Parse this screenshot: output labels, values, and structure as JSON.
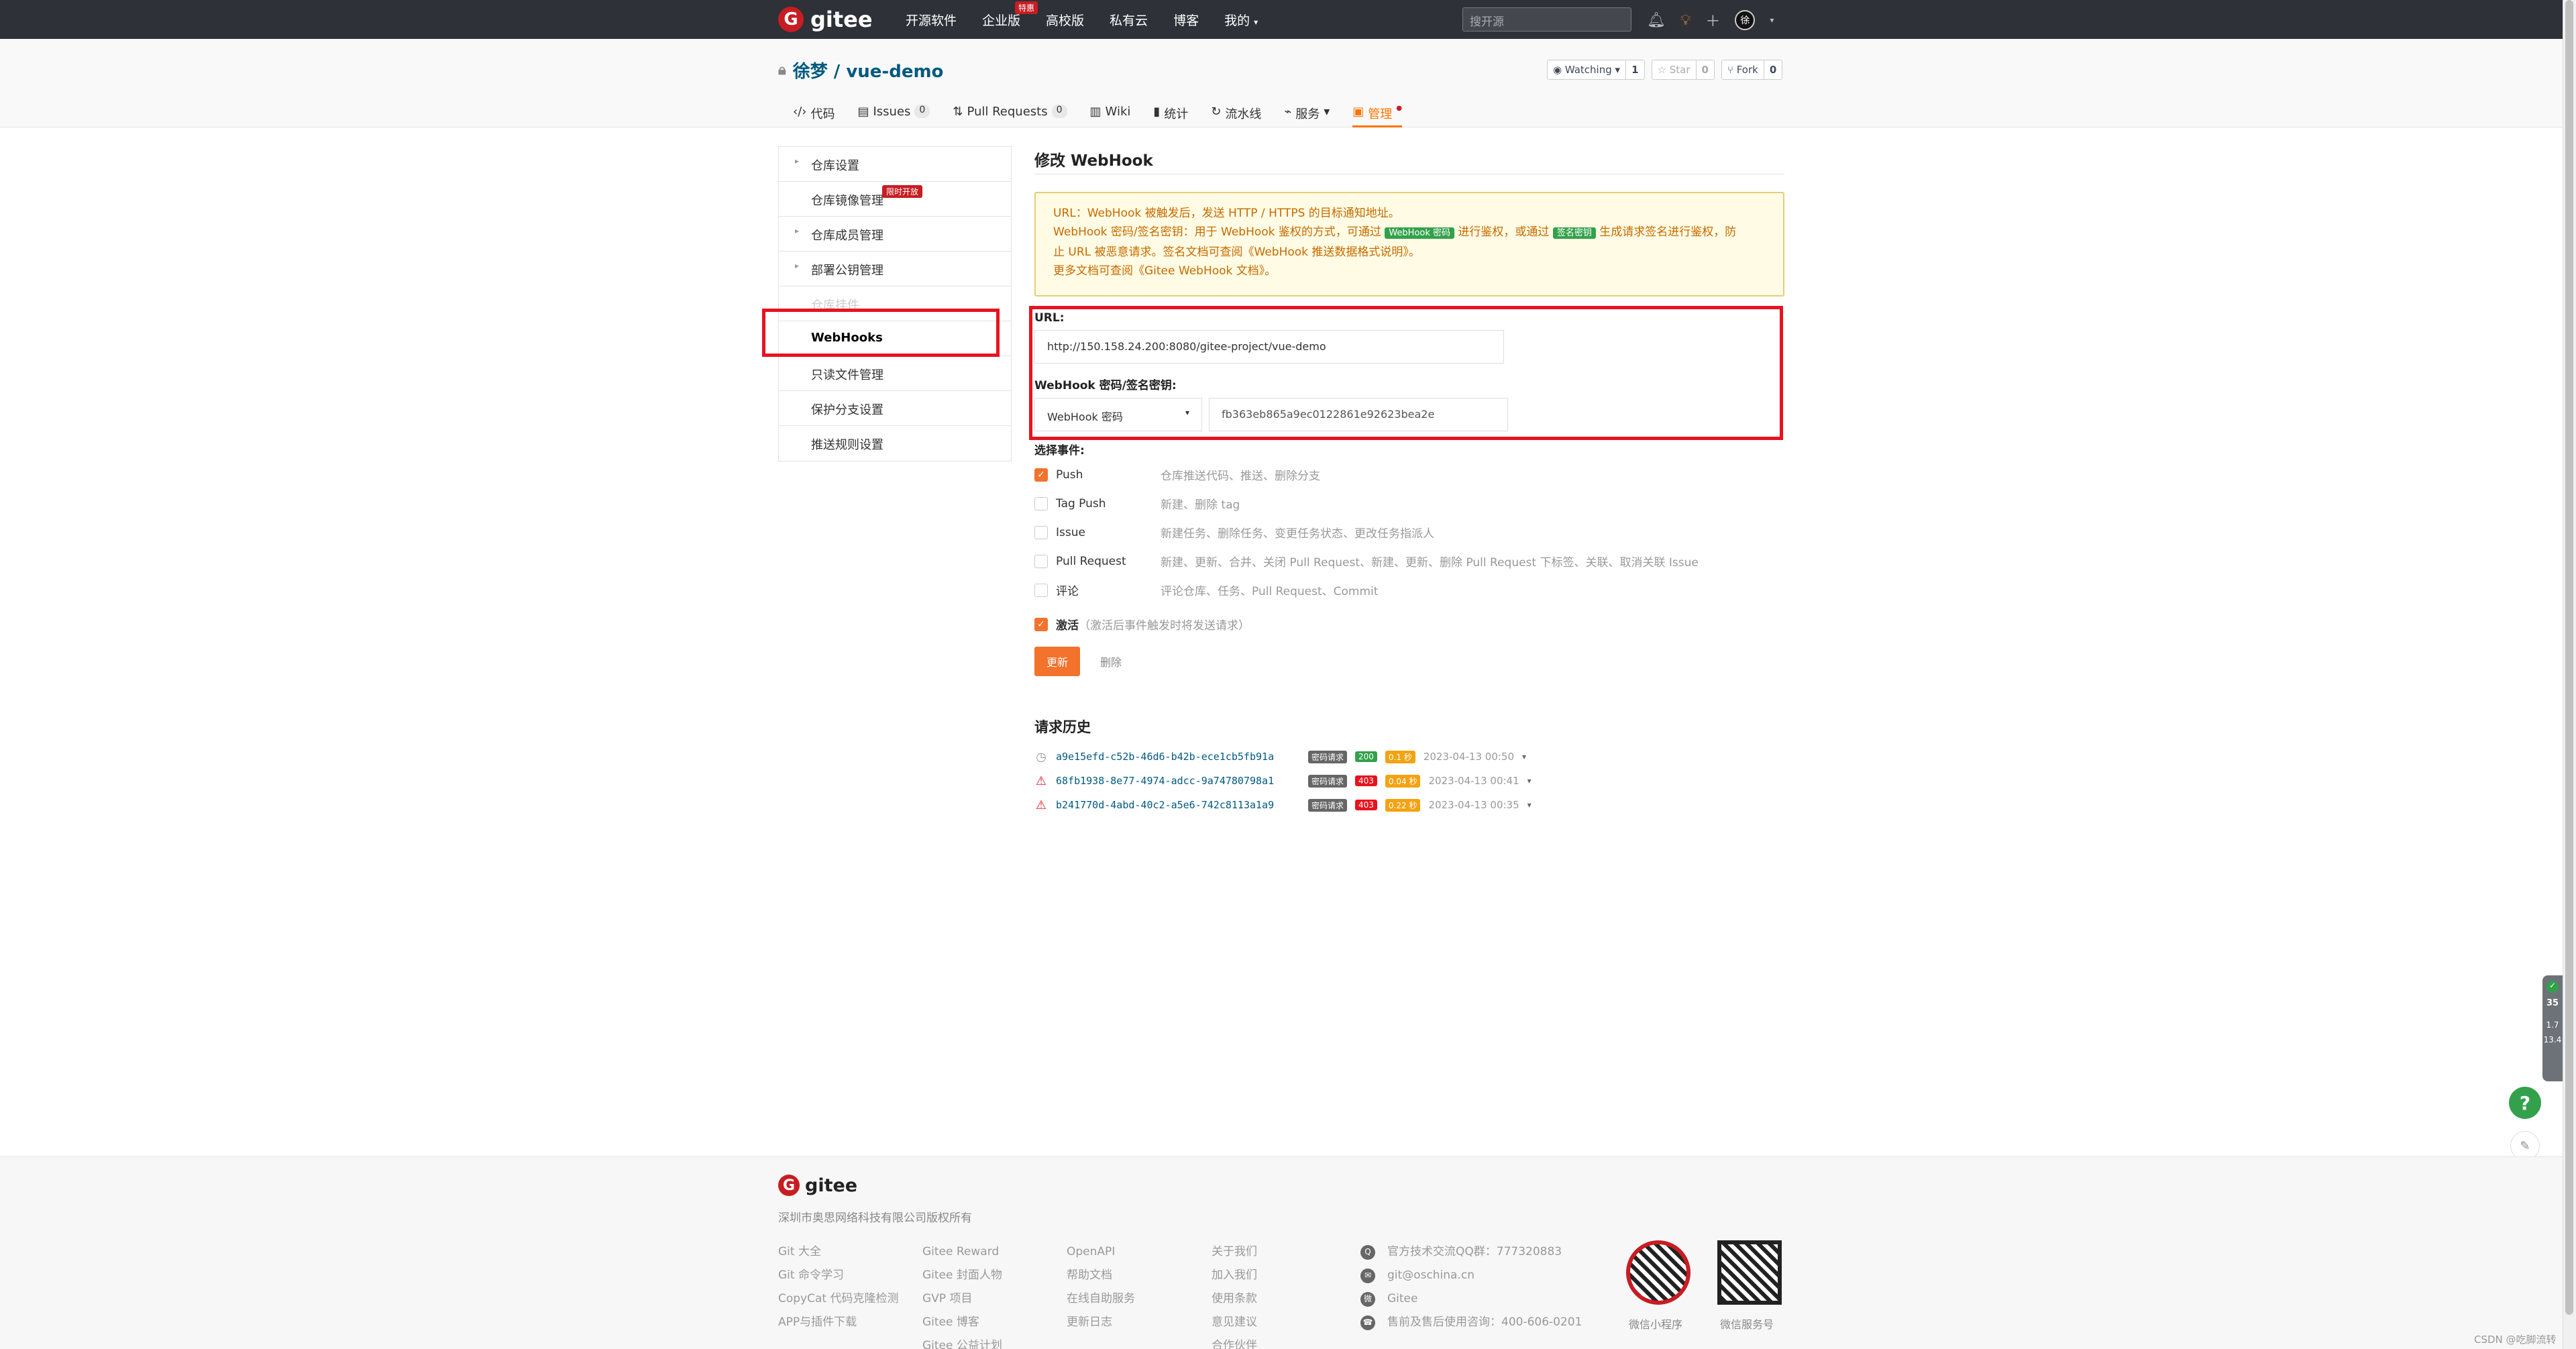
{
  "topbar": {
    "logo_text": "gitee",
    "nav": [
      "开源软件",
      "企业版",
      "高校版",
      "私有云",
      "博客",
      "我的"
    ],
    "enterprise_badge": "特惠",
    "search_placeholder": "搜开源",
    "avatar_text": "徐"
  },
  "repo": {
    "title": "徐梦 / vue-demo",
    "watching_label": "Watching",
    "watching_count": "1",
    "star_label": "Star",
    "star_count": "0",
    "fork_label": "Fork",
    "fork_count": "0"
  },
  "tabs": [
    {
      "label": "代码"
    },
    {
      "label": "Issues",
      "count": "0"
    },
    {
      "label": "Pull Requests",
      "count": "0"
    },
    {
      "label": "Wiki"
    },
    {
      "label": "统计"
    },
    {
      "label": "流水线"
    },
    {
      "label": "服务"
    },
    {
      "label": "管理"
    }
  ],
  "sidebar": {
    "items": [
      {
        "label": "仓库设置"
      },
      {
        "label": "仓库镜像管理",
        "badge": "限时开放"
      },
      {
        "label": "仓库成员管理"
      },
      {
        "label": "部署公钥管理"
      },
      {
        "label": "仓库挂件"
      },
      {
        "label": "WebHooks"
      },
      {
        "label": "只读文件管理"
      },
      {
        "label": "保护分支设置"
      },
      {
        "label": "推送规则设置"
      }
    ]
  },
  "main": {
    "title": "修改 WebHook",
    "notice": {
      "line1": "URL：WebHook 被触发后，发送 HTTP / HTTPS 的目标通知地址。",
      "line2a": "WebHook 密码/签名密钥：用于 WebHook 鉴权的方式，可通过",
      "tag1": "WebHook 密码",
      "line2b": "进行鉴权，或通过",
      "tag2": "签名密钥",
      "line2c": "生成请求签名进行鉴权，防",
      "line3": "止 URL 被恶意请求。签名文档可查阅《WebHook 推送数据格式说明》。",
      "line4": "更多文档可查阅《Gitee WebHook 文档》。"
    },
    "url_label": "URL:",
    "url_value": "http://150.158.24.200:8080/gitee-project/vue-demo",
    "secret_label": "WebHook 密码/签名密钥:",
    "secret_type": "WebHook 密码",
    "secret_value": "fb363eb865a9ec0122861e92623bea2e",
    "events_label": "选择事件:",
    "events": [
      {
        "name": "Push",
        "desc": "仓库推送代码、推送、删除分支"
      },
      {
        "name": "Tag Push",
        "desc": "新建、删除 tag"
      },
      {
        "name": "Issue",
        "desc": "新建任务、删除任务、变更任务状态、更改任务指派人"
      },
      {
        "name": "Pull Request",
        "desc": "新建、更新、合并、关闭 Pull Request、新建、更新、删除 Pull Request 下标签、关联、取消关联 Issue"
      },
      {
        "name": "评论",
        "desc": "评论仓库、任务、Pull Request、Commit"
      }
    ],
    "active_label": "激活",
    "active_desc": "（激活后事件触发时将发送请求）",
    "update_btn": "更新",
    "delete_btn": "删除",
    "history_title": "请求历史",
    "history": [
      {
        "id": "a9e15efd-c52b-46d6-b42b-ece1cb5fb91a",
        "type": "密码请求",
        "code": "200",
        "time": "0.1 秒",
        "date": "2023-04-13 00:50"
      },
      {
        "id": "68fb1938-8e77-4974-adcc-9a74780798a1",
        "type": "密码请求",
        "code": "403",
        "time": "0.04 秒",
        "date": "2023-04-13 00:41"
      },
      {
        "id": "b241770d-4abd-40c2-a5e6-742c8113a1a9",
        "type": "密码请求",
        "code": "403",
        "time": "0.22 秒",
        "date": "2023-04-13 00:35"
      }
    ]
  },
  "footer": {
    "logo_text": "gitee",
    "copyright": "深圳市奥思网络科技有限公司版权所有",
    "col1": [
      "Git 大全",
      "Git 命令学习",
      "CopyCat 代码克隆检测",
      "APP与插件下载"
    ],
    "col2": [
      "Gitee Reward",
      "Gitee 封面人物",
      "GVP 项目",
      "Gitee 博客",
      "Gitee 公益计划"
    ],
    "col3": [
      "OpenAPI",
      "帮助文档",
      "在线自助服务",
      "更新日志"
    ],
    "col4": [
      "关于我们",
      "加入我们",
      "使用条款",
      "意见建议",
      "合作伙伴"
    ],
    "contact": [
      "官方技术交流QQ群：777320883",
      "git@oschina.cn",
      "Gitee",
      "售前及售后使用咨询：400-606-0201"
    ],
    "qr1_label": "微信小程序",
    "qr2_label": "微信服务号"
  },
  "watermark": "CSDN @吃脚流转",
  "widget": {
    "a": "35",
    "b": "1.7",
    "c": "13.4"
  },
  "colors": {
    "accent": "#fe7300",
    "brand": "#c71d23",
    "success": "#33a14b",
    "danger": "#e8131f"
  }
}
